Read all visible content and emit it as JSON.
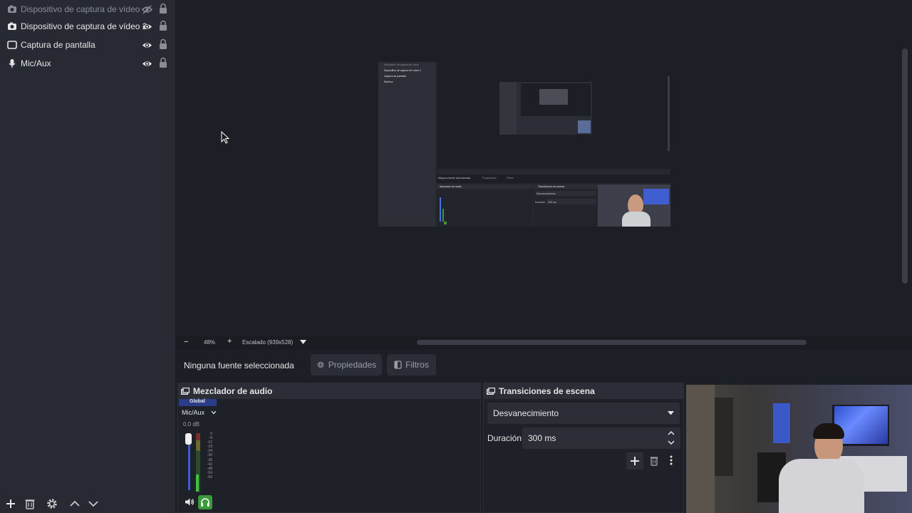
{
  "sources": {
    "items": [
      {
        "label": "Dispositivo de captura de vídeo",
        "icon": "camera-icon",
        "visible": false
      },
      {
        "label": "Dispositivo de captura de vídeo 2",
        "icon": "camera-icon",
        "visible": true
      },
      {
        "label": "Captura de pantalla",
        "icon": "monitor-icon",
        "visible": true
      },
      {
        "label": "Mic/Aux",
        "icon": "microphone-icon",
        "visible": true
      }
    ],
    "toolbar": [
      "add-icon",
      "trash-icon",
      "gear-icon",
      "arrow-up-icon",
      "arrow-down-icon"
    ]
  },
  "zoom": {
    "minus": "−",
    "percent": "48%",
    "plus": "+",
    "scale_label": "Escalado (939x528)"
  },
  "context": {
    "no_source": "Ninguna fuente seleccionada",
    "properties": "Propiedades",
    "filters": "Filtros"
  },
  "mixer": {
    "title": "Mezclador de audio",
    "channel": {
      "tab": "Global",
      "name": "Mic/Aux",
      "level": "0.0 dB",
      "scale": [
        "0",
        "-6",
        "-12",
        "-18",
        "-24",
        "-30",
        "-36",
        "-42",
        "-48",
        "-54",
        "-60"
      ]
    }
  },
  "transitions": {
    "title": "Transiciones de escena",
    "selected": "Desvanecimiento",
    "duration_label": "Duración",
    "duration_value": "300 ms"
  },
  "nested": {
    "items": [
      "Dispositivo de captura de vídeo",
      "Dispositivo de captura de vídeo 2",
      "Captura de pantalla",
      "Mic/Aux"
    ],
    "no_source": "Ninguna fuente seleccionada",
    "properties": "Propiedades",
    "filters": "Filtros",
    "mixer_title": "Mezclador de audio",
    "trans_title": "Transiciones de escena",
    "trans_selected": "Desvanecimiento",
    "duration_label": "Duración",
    "duration_value": "300 ms"
  },
  "colors": {
    "panel": "#272a33",
    "background": "#1d1f26",
    "accent_green": "#3a9a3a",
    "meter_blue": "#4a6de0"
  }
}
